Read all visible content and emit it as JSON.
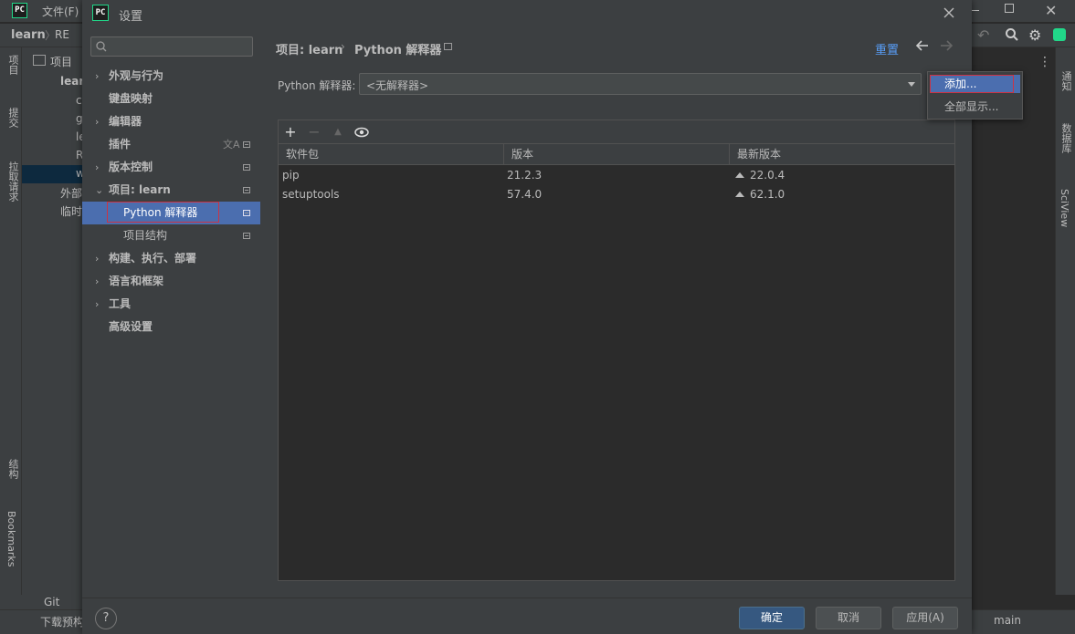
{
  "ide": {
    "logo": "PC",
    "menu_file": "文件(F)",
    "breadcrumb_project": "learn",
    "breadcrumb_file": "RE",
    "left_tabs": [
      "项目",
      "提交",
      "拉取请求",
      "结构",
      "Bookmarks"
    ],
    "right_tabs": [
      "通知",
      "数据库",
      "SciView"
    ],
    "project_panel_title": "项目",
    "tree": [
      "lear",
      "c",
      "g",
      "le",
      "R",
      "w",
      "外部",
      "临时"
    ],
    "bottom_tab": "Git",
    "status_left": "下载预构",
    "status_branch": "main"
  },
  "dialog": {
    "logo": "PC",
    "title": "设置",
    "search_placeholder": "",
    "tree": [
      {
        "label": "外观与行为",
        "arrow": "›",
        "badge": false
      },
      {
        "label": "键盘映射",
        "arrow": "",
        "badge": false
      },
      {
        "label": "编辑器",
        "arrow": "›",
        "badge": false
      },
      {
        "label": "插件",
        "arrow": "",
        "badge": true
      },
      {
        "label": "版本控制",
        "arrow": "›",
        "badge": true
      },
      {
        "label": "项目: learn",
        "arrow": "⌄",
        "badge": true
      },
      {
        "label": "Python 解释器",
        "arrow": "",
        "badge": true
      },
      {
        "label": "项目结构",
        "arrow": "",
        "badge": true
      },
      {
        "label": "构建、执行、部署",
        "arrow": "›",
        "badge": false
      },
      {
        "label": "语言和框架",
        "arrow": "›",
        "badge": false
      },
      {
        "label": "工具",
        "arrow": "›",
        "badge": false
      },
      {
        "label": "高级设置",
        "arrow": "",
        "badge": false
      }
    ],
    "breadcrumb": {
      "project": "项目: learn",
      "separator": "›",
      "page": "Python 解释器"
    },
    "reset_label": "重置",
    "interpreter_label": "Python 解释器:",
    "interpreter_value": "<无解释器>",
    "toolbar": {
      "add": "+",
      "remove": "−",
      "upgrade": "▲",
      "show": "eye-icon"
    },
    "packages": {
      "columns": [
        "软件包",
        "版本",
        "最新版本"
      ],
      "rows": [
        {
          "name": "pip",
          "version": "21.2.3",
          "latest": "22.0.4"
        },
        {
          "name": "setuptools",
          "version": "57.4.0",
          "latest": "62.1.0"
        }
      ]
    },
    "popup": {
      "add": "添加...",
      "show_all": "全部显示..."
    },
    "footer": {
      "help": "?",
      "ok": "确定",
      "cancel": "取消",
      "apply": "应用(A)"
    }
  }
}
